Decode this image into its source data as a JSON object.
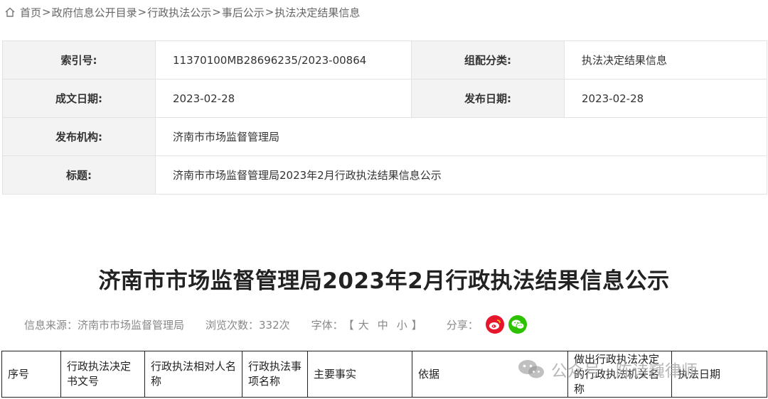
{
  "breadcrumb": {
    "items": [
      "首页",
      "政府信息公开目录",
      "行政执法公示",
      "事后公示",
      "执法决定结果信息"
    ],
    "separator": ">"
  },
  "meta": {
    "index_label": "索引号:",
    "index_value": "11370100MB28696235/2023-00864",
    "category_label": "组配分类:",
    "category_value": "执法决定结果信息",
    "date_label": "成文日期:",
    "date_value": "2023-02-28",
    "publish_label": "发布日期:",
    "publish_value": "2023-02-28",
    "org_label": "发布机构:",
    "org_value": "济南市市场监督管理局",
    "subject_label": "标题:",
    "subject_value": "济南市市场监督管理局2023年2月行政执法结果信息公示"
  },
  "article": {
    "title": "济南市市场监督管理局2023年2月行政执法结果信息公示"
  },
  "info": {
    "source": "信息来源：济南市市场监督管理局",
    "views": "浏览次数：332次",
    "font_label": "字体：",
    "font_open": "【",
    "font_large": "大",
    "font_medium": "中",
    "font_small": "小",
    "font_close": "】",
    "share_label": "分享："
  },
  "table": {
    "headers": [
      "序号",
      "行政执法决定书文号",
      "行政执法相对人名称",
      "行政执法事项名称",
      "主要事实",
      "依据",
      "做出行政执法决定的行政执法机关名称",
      "执法日期"
    ]
  },
  "watermark": {
    "text": "公众号 · 陈诗巍律师"
  },
  "colors": {
    "weibo": "#e6162d",
    "wechat": "#2dc100",
    "label_bg": "#f3f3f3"
  }
}
